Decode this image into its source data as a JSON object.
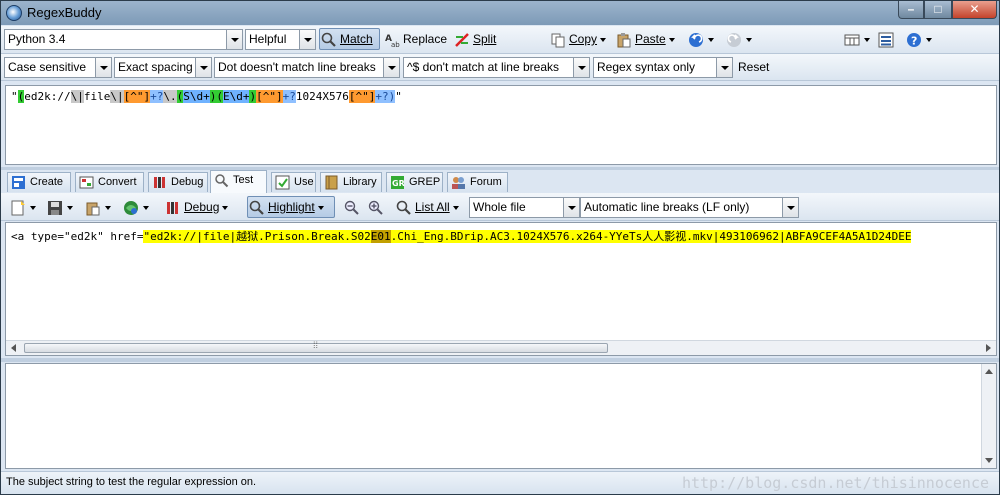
{
  "window": {
    "title": "RegexBuddy"
  },
  "toolbar1": {
    "flavor": "Python 3.4",
    "helper": "Helpful",
    "match_label": "Match",
    "replace_label": "Replace",
    "split_label": "Split",
    "copy_label": "Copy",
    "paste_label": "Paste"
  },
  "toolbar2": {
    "case": "Case sensitive",
    "spacing": "Exact spacing",
    "dot": "Dot doesn't match line breaks",
    "anchors": "^$ don't match at line breaks",
    "syntax": "Regex syntax only",
    "reset_label": "Reset"
  },
  "regex": {
    "open_quote": "\"",
    "p1": "(",
    "p2": "ed2k://",
    "p3": "\\|",
    "p4": "file",
    "p5": "\\|",
    "p6": "[^\"]",
    "p7": "+?",
    "p8": "\\.",
    "p9": "(",
    "p10": "S\\d+",
    "p11": ")",
    "p12": "(",
    "p13": "E\\d+",
    "p14": ")",
    "p15": "[^\"]",
    "p16": "+?",
    "p17": "1024X576",
    "p18": "[^\"]",
    "p19": "+?",
    "p20": ")",
    "close_quote": "\""
  },
  "tabs": [
    {
      "label": "Create"
    },
    {
      "label": "Convert"
    },
    {
      "label": "Debug"
    },
    {
      "label": "Test"
    },
    {
      "label": "Use"
    },
    {
      "label": "Library"
    },
    {
      "label": "GREP"
    },
    {
      "label": "Forum"
    }
  ],
  "test_toolbar": {
    "debug_label": "Debug",
    "highlight_label": "Highlight",
    "listall_label": "List All",
    "scope": "Whole file",
    "linebreaks": "Automatic line breaks (LF only)"
  },
  "test_text": {
    "prefix": "<a type=\"ed2k\" href=",
    "match_a": "\"ed2k://|file|越狱.Prison.Break.S02",
    "match_b": "E01",
    "match_c": ".Chi_Eng.BDrip.AC3.1024X576.x264-YYeTs人人影视.mkv|493106962|ABFA9CEF4A5A1D24DEE"
  },
  "status": {
    "text": "The subject string to test the regular expression on.",
    "watermark": "http://blog.csdn.net/thisinnocence"
  },
  "colors": {
    "group": "#33cc33",
    "class": "#ff9a30",
    "quantifier": "#8fc0ff",
    "match": "#ffff00"
  }
}
